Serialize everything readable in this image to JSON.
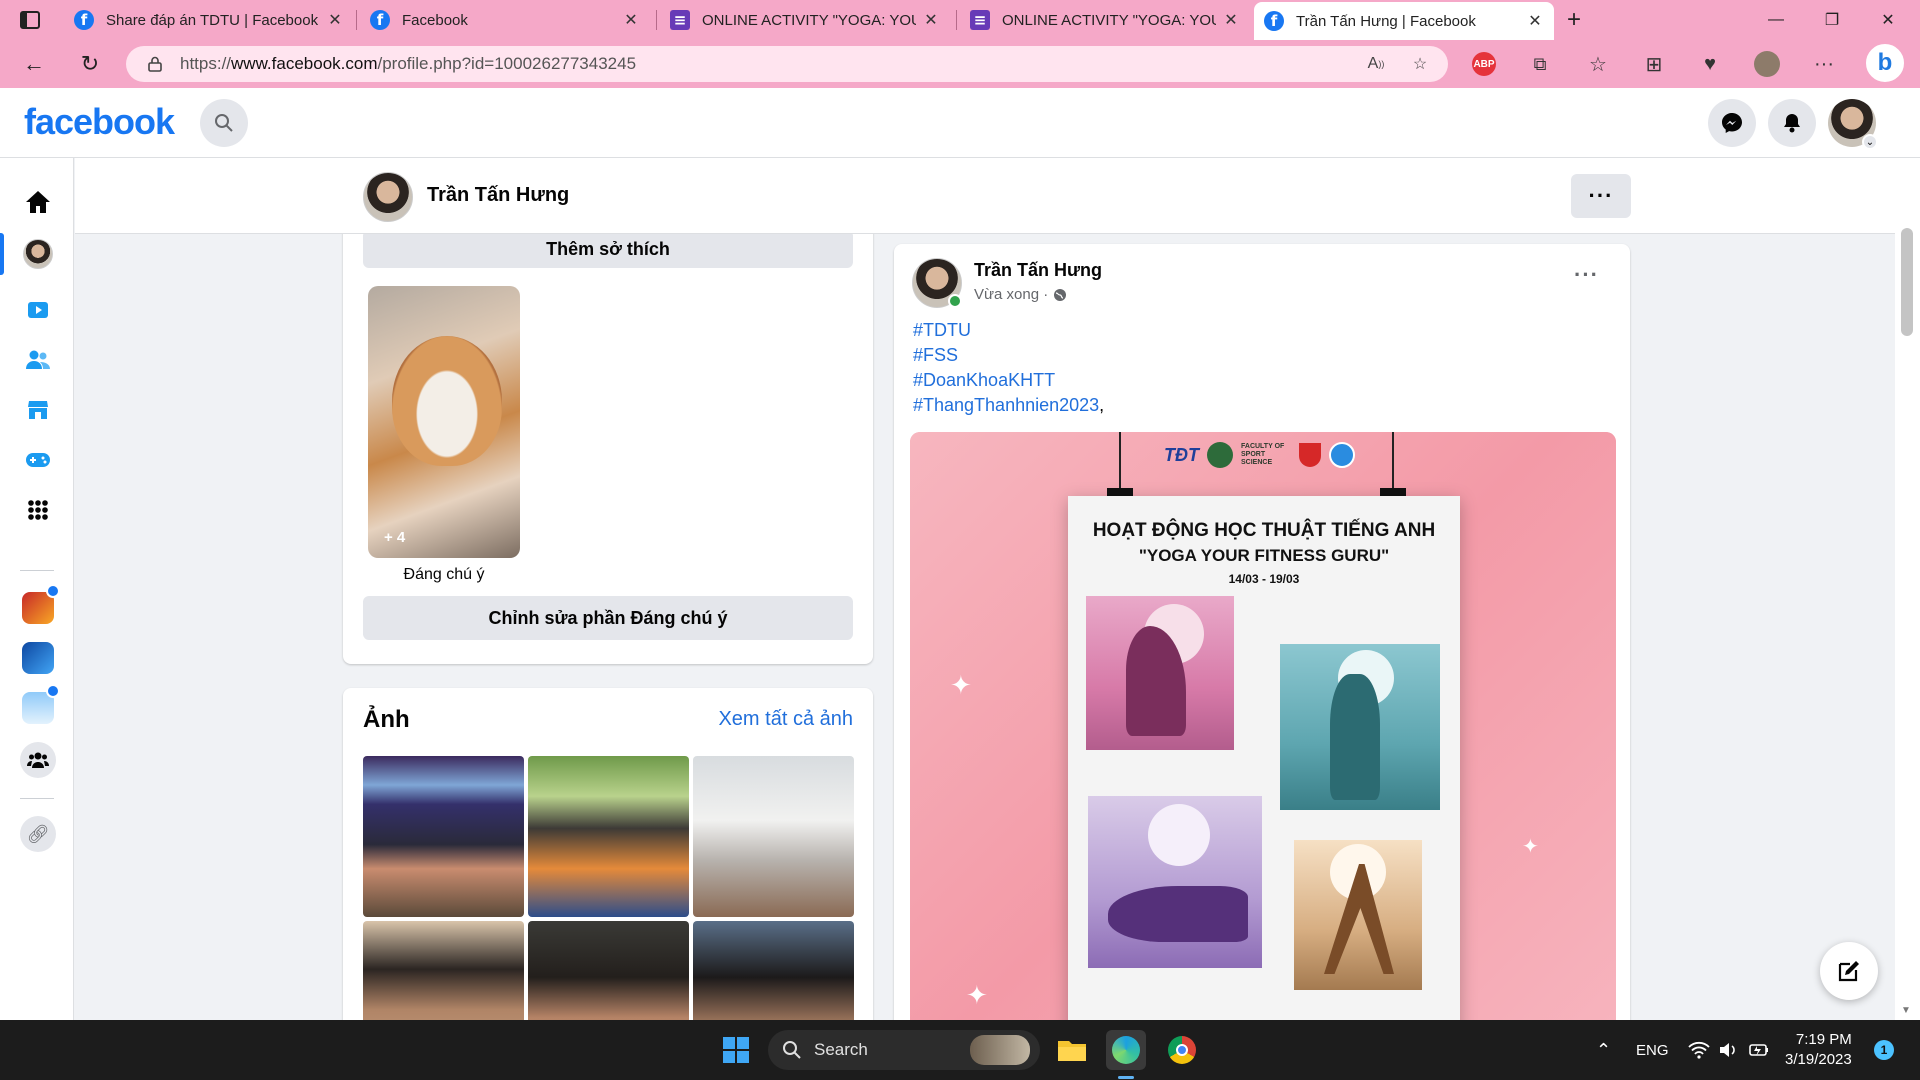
{
  "browser": {
    "tabs": [
      {
        "title": "Share đáp án TDTU | Facebook",
        "icon": "facebook-icon"
      },
      {
        "title": "Facebook",
        "icon": "facebook-icon"
      },
      {
        "title": "ONLINE ACTIVITY \"YOGA: YOUR",
        "icon": "forms-icon"
      },
      {
        "title": "ONLINE ACTIVITY \"YOGA: YOUR",
        "icon": "forms-icon"
      },
      {
        "title": "Trần Tấn Hưng | Facebook",
        "icon": "facebook-icon"
      }
    ],
    "url_prefix": "https://",
    "url_host": "www.facebook.com",
    "url_path": "/profile.php?id=100026277343245",
    "abp_label": "ABP",
    "accent": "#f5a8c8"
  },
  "facebook": {
    "logo": "facebook",
    "brand_color": "#1877f2"
  },
  "profile": {
    "name": "Trần Tấn Hưng",
    "add_hobbies": "Thêm sở thích",
    "featured_count": "+ 4",
    "featured_label": "Đáng chú ý",
    "edit_featured": "Chỉnh sửa phần Đáng chú ý",
    "photos_title": "Ảnh",
    "see_all_photos": "Xem tất cả ảnh"
  },
  "post": {
    "author": "Trần Tấn Hưng",
    "time": "Vừa xong ·",
    "hashtags": [
      "#TDTU",
      "#FSS",
      "#DoanKhoaKHTT",
      "#ThangThanhnien2023"
    ],
    "hashtag_suffix": ",",
    "poster": {
      "title": "HOẠT ĐỘNG HỌC THUẬT TIẾNG ANH",
      "subtitle": "\"YOGA YOUR FITNESS GURU\"",
      "dates": "14/03 - 19/03",
      "org_text": "FACULTY OF SPORT SCIENCE"
    }
  },
  "taskbar": {
    "search_label": "Search",
    "language": "ENG",
    "time": "7:19 PM",
    "date": "3/19/2023",
    "notification_count": "1"
  }
}
